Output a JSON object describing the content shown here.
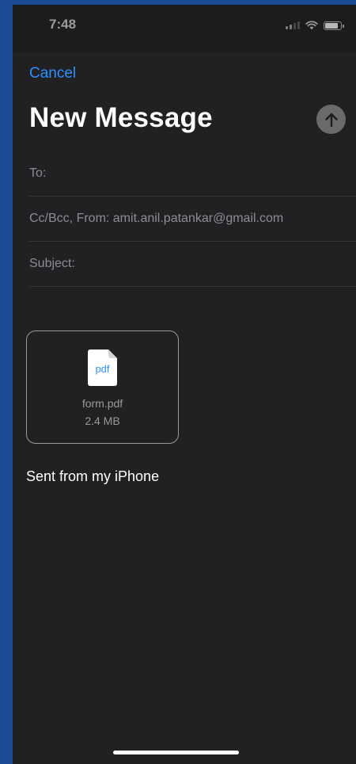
{
  "status_bar": {
    "time": "7:48",
    "icons": [
      "signal-icon",
      "wifi-icon",
      "battery-icon"
    ]
  },
  "compose": {
    "cancel_label": "Cancel",
    "title": "New Message",
    "send_icon": "arrow-up-icon",
    "to_label": "To:",
    "cc_from_label": "Cc/Bcc, From:  amit.anil.patankar@gmail.com",
    "subject_label": "Subject:",
    "attachment": {
      "icon": "pdf-file-icon",
      "type_label": "pdf",
      "file_name": "form.pdf",
      "file_size": "2.4 MB"
    },
    "signature": "Sent from my iPhone"
  },
  "colors": {
    "accent": "#2f8fff",
    "background": "#212123",
    "outer_background": "#1b4a94"
  }
}
